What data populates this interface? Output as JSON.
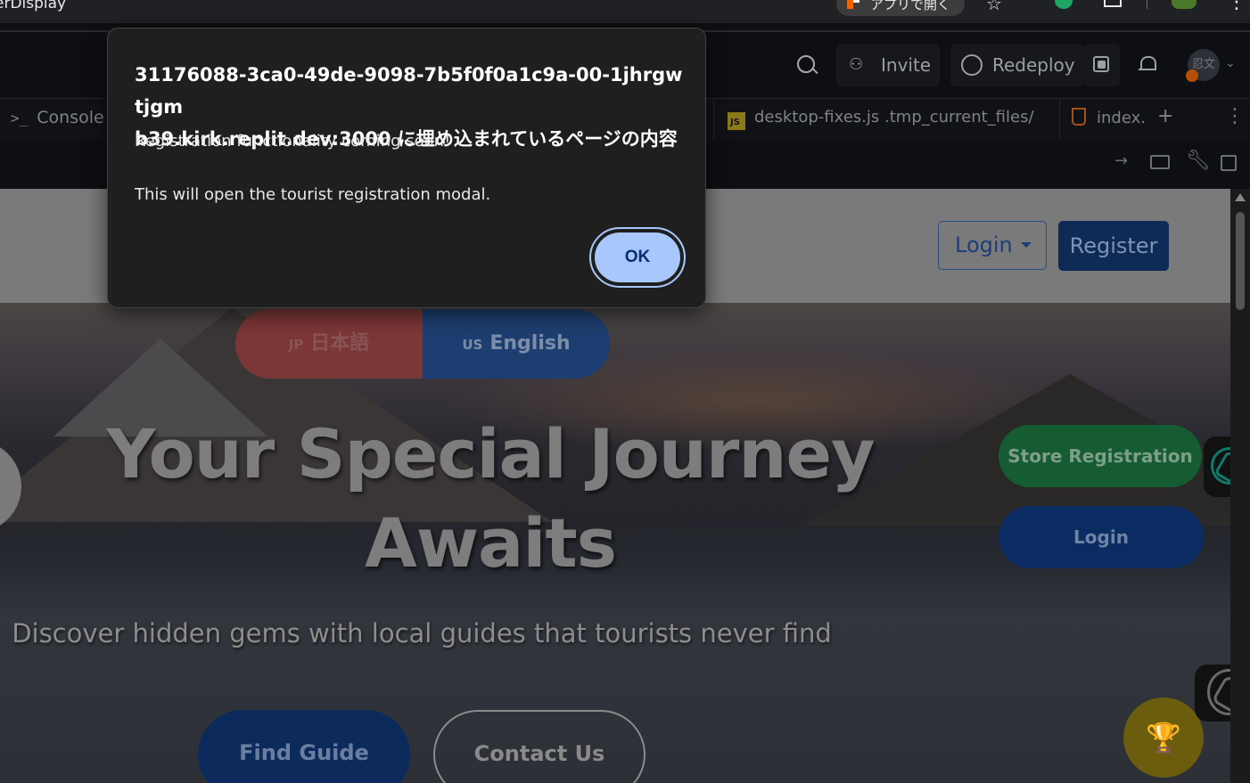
{
  "browser": {
    "title_fragment": "erDisplay",
    "open_in_app": "アプリで開く",
    "icons": [
      "replit-logo-icon",
      "star-icon",
      "chatgpt-extension-icon",
      "puzzle-icon",
      "profile-icon",
      "kebab-menu-icon"
    ]
  },
  "replit": {
    "header": {
      "invite_label": "Invite",
      "redeploy_label": "Redeploy",
      "avatar_text": "忍文"
    },
    "tabs": {
      "console_label": "Console",
      "file_tab_label": "desktop-fixes.js .tmp_current_files/",
      "file_tab_icon_text": "JS",
      "index_tab_label": "index."
    }
  },
  "site": {
    "header": {
      "login_label": "Login",
      "register_label": "Register"
    },
    "language": {
      "jp_flag": "JP",
      "jp_label": "日本語",
      "en_flag": "US",
      "en_label": "English"
    },
    "hero": {
      "title_line1": "Your Special Journey",
      "title_line2": "Awaits",
      "subtitle": "Discover hidden gems with local guides that tourists never find",
      "find_guide_label": "Find Guide",
      "contact_label": "Contact Us"
    },
    "side": {
      "store_registration_label": "Store Registration",
      "login_label": "Login",
      "trophy_glyph": "🏆"
    }
  },
  "dialog": {
    "origin_line1": "31176088-3ca0-49de-9098-7b5f0f0a1c9a-00-1jhrgwtjgm",
    "origin_line2": "b39.kirk.replit.dev:3000 に埋め込まれているページの内容",
    "message_line1": "Registration functionality coming soon!",
    "message_line2": "This will open the tourist registration modal.",
    "ok_label": "OK",
    "ok_color": "#a8c7fa"
  }
}
